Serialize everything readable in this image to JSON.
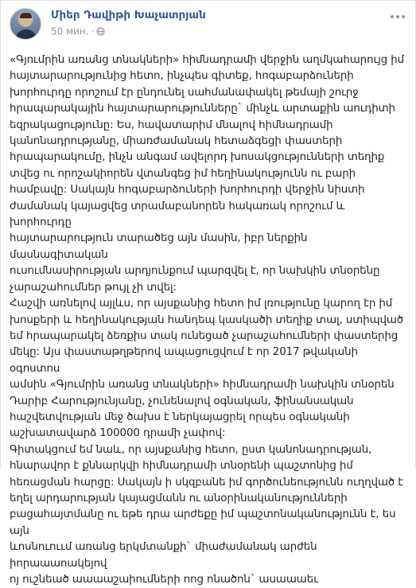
{
  "author": {
    "name": "Միեր Դավիթի Խաչատրյան"
  },
  "post_meta": {
    "time": "50 мин.",
    "separator": "·",
    "privacy_icon": "globe-icon"
  },
  "menu": {
    "icon": "more-horizontal-icon"
  },
  "body": {
    "text": "«Գյումրին առանց տնակների» հիմնադրամի վերջին աղմկահարույց իմ\nհայտարարությունից հետո, ինչպես գիտեք, հոգաբարձուների\nխորհուրդը որոշում էր ընդունել սահմանափակել թեմայի շուրջ\nհրապարակային հայտարարությունները` մինչև արտաքին աուդիտի\nեզրակացությունը: Ես, հավատարիմ մնալով հիմնադրամի\nկանոնադրությանը, միառժամանակ հետաձգեցի փաստերի\nհրապարակումը, ինչն անգամ ավելորդ խոսակցությունների տեղիք\nտվեց ու որոշակիորեն վտանգեց իմ հեղինակությունն ու բարի\nհամբավը: Սակայն հոգաբարձուների խորհուրդի վերջին նիստի\nժամանակ կայացվեց տրամաբանորեն հակառակ որոշում և խորհուրդը\nհայտարարություն տարածեց այն մասին, իբր ներքին մասնագիտական\nուսումնասիրության արդյունքում պարզվել է, որ նախկին տնօրենը\nչարաշահումներ թույլ չի տվել:\nՀաշվի առնելով այլևս, որ այսքանից հետո իմ լռությունը կարող էր իմ\nխոսքերի և հեղինակության հանդեպ կասկածի տեղիք տալ, ստիպված\nեմ հրապարակել ձեռքիս տակ ունեցած չարաշահումների փաստերից\nմեկը: Այս փաստաթղթերով ապացուցվում է որ 2017 թվականի օգոստոս\nամսին «Գյումրին առանց տնակների» հիմնադրամի նախկին տնօրեն\nԴարիբ Հարությունյանը, չունենալով օգնական, ֆինանսական\nհաշվետվության մեջ ծախս է ներկայացրել որպես օգնականի\nաշխատավարձ 100000 դրամի չափով:\nԳիտակցում եմ նաև, որ այսքանից հետո, ըստ կանոնադրության,\nհնարավոր է քննարկվի հիմնադրամի տնօրենի պաշտոնից իմ\nհեռացման հարցը: Սակայն ի սկզբանե իմ գործունեությունն ուղղված է\nեղել արդարության կայացմանն ու անօրինականությունների\nբացահայտմանը ու եթե դրա արժեքը իմ պաշտոնականությունն է, ես այն\nևոսնուոււմ առանց երկմտանքի` միաժամանակ արժեն իորաաաոակեյով\nոյ ուշնեած աաաաշաիումների ոոց ոնածոն` ասաաաեւ"
  }
}
